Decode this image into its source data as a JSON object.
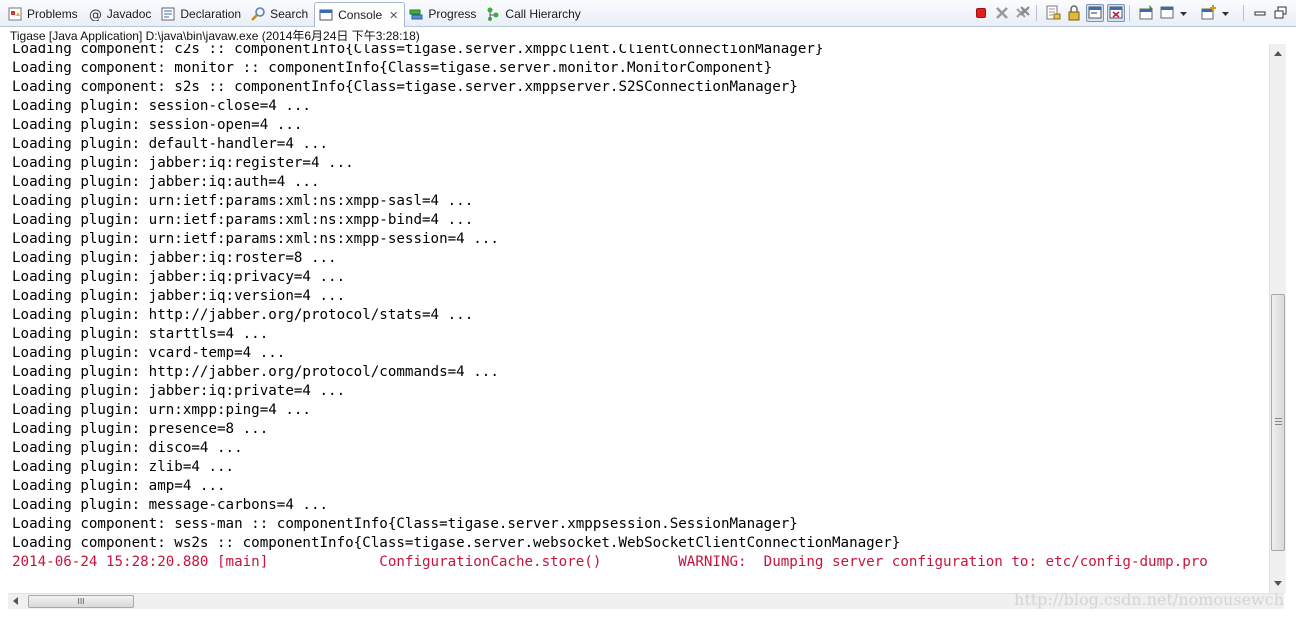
{
  "tabs": [
    {
      "label": "Problems",
      "icon": "problems-icon"
    },
    {
      "label": "Javadoc",
      "icon": "at-icon"
    },
    {
      "label": "Declaration",
      "icon": "declaration-icon"
    },
    {
      "label": "Search",
      "icon": "search-icon"
    },
    {
      "label": "Console",
      "icon": "console-icon",
      "active": true
    },
    {
      "label": "Progress",
      "icon": "progress-icon"
    },
    {
      "label": "Call Hierarchy",
      "icon": "call-hierarchy-icon"
    }
  ],
  "process_label": "Tigase [Java Application] D:\\java\\bin\\javaw.exe (2014年6月24日 下午3:28:18)",
  "console_lines": [
    "Loading component: c2s :: componentInfo{Class=tigase.server.xmppclient.ClientConnectionManager}",
    "Loading component: monitor :: componentInfo{Class=tigase.server.monitor.MonitorComponent}",
    "Loading component: s2s :: componentInfo{Class=tigase.server.xmppserver.S2SConnectionManager}",
    "Loading plugin: session-close=4 ...",
    "Loading plugin: session-open=4 ...",
    "Loading plugin: default-handler=4 ...",
    "Loading plugin: jabber:iq:register=4 ...",
    "Loading plugin: jabber:iq:auth=4 ...",
    "Loading plugin: urn:ietf:params:xml:ns:xmpp-sasl=4 ...",
    "Loading plugin: urn:ietf:params:xml:ns:xmpp-bind=4 ...",
    "Loading plugin: urn:ietf:params:xml:ns:xmpp-session=4 ...",
    "Loading plugin: jabber:iq:roster=8 ...",
    "Loading plugin: jabber:iq:privacy=4 ...",
    "Loading plugin: jabber:iq:version=4 ...",
    "Loading plugin: http://jabber.org/protocol/stats=4 ...",
    "Loading plugin: starttls=4 ...",
    "Loading plugin: vcard-temp=4 ...",
    "Loading plugin: http://jabber.org/protocol/commands=4 ...",
    "Loading plugin: jabber:iq:private=4 ...",
    "Loading plugin: urn:xmpp:ping=4 ...",
    "Loading plugin: presence=8 ...",
    "Loading plugin: disco=4 ...",
    "Loading plugin: zlib=4 ...",
    "Loading plugin: amp=4 ...",
    "Loading plugin: message-carbons=4 ...",
    "Loading component: sess-man :: componentInfo{Class=tigase.server.xmppsession.SessionManager}",
    "Loading component: ws2s :: componentInfo{Class=tigase.server.websocket.WebSocketClientConnectionManager}"
  ],
  "warning_line": "2014-06-24 15:28:20.880 [main]             ConfigurationCache.store()         WARNING:  Dumping server configuration to: etc/config-dump.pro",
  "hscroll_grip": "III",
  "watermark": "http://blog.csdn.net/nomousewch",
  "colors": {
    "error_text": "#c8143c",
    "terminate_red": "#e0201e"
  },
  "toolbar_icons": [
    "terminate-icon",
    "remove-launch-icon",
    "remove-all-terminated-icon",
    "clear-console-icon",
    "scroll-lock-icon",
    "show-on-stdout-icon",
    "show-on-stderr-icon",
    "pin-console-icon",
    "display-selected-console-icon",
    "open-console-icon",
    "view-menu-icon",
    "minimize-icon",
    "maximize-icon"
  ]
}
